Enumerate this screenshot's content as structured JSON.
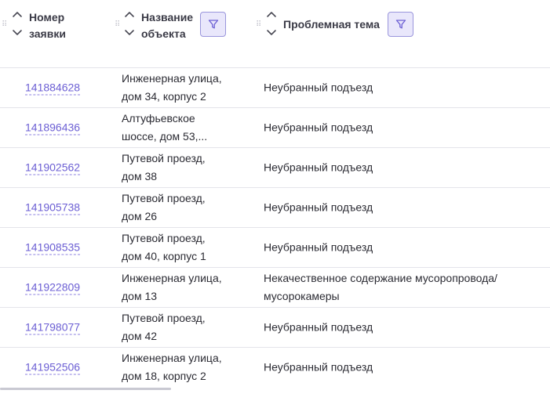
{
  "columns": {
    "number": {
      "title_line1": "Номер",
      "title_line2": "заявки"
    },
    "object": {
      "title_line1": "Название",
      "title_line2": "объекта"
    },
    "topic": {
      "title_line1": "Проблемная тема"
    }
  },
  "rows": [
    {
      "number": "141884628",
      "object_line1": "Инженерная улица,",
      "object_line2": "дом 34, корпус 2",
      "topic_line1": "Неубранный подъезд",
      "topic_line2": ""
    },
    {
      "number": "141896436",
      "object_line1": "Алтуфьевское",
      "object_line2": "шоссе, дом 53,...",
      "topic_line1": "Неубранный подъезд",
      "topic_line2": ""
    },
    {
      "number": "141902562",
      "object_line1": "Путевой проезд,",
      "object_line2": "дом 38",
      "topic_line1": "Неубранный подъезд",
      "topic_line2": ""
    },
    {
      "number": "141905738",
      "object_line1": "Путевой проезд,",
      "object_line2": "дом 26",
      "topic_line1": "Неубранный подъезд",
      "topic_line2": ""
    },
    {
      "number": "141908535",
      "object_line1": "Путевой проезд,",
      "object_line2": "дом 40, корпус 1",
      "topic_line1": "Неубранный подъезд",
      "topic_line2": ""
    },
    {
      "number": "141922809",
      "object_line1": "Инженерная улица,",
      "object_line2": "дом 13",
      "topic_line1": "Некачественное содержание мусоропровода/",
      "topic_line2": "мусорокамеры"
    },
    {
      "number": "141798077",
      "object_line1": "Путевой проезд,",
      "object_line2": "дом 42",
      "topic_line1": "Неубранный подъезд",
      "topic_line2": ""
    },
    {
      "number": "141952506",
      "object_line1": "Инженерная улица,",
      "object_line2": "дом 18, корпус 2",
      "topic_line1": "Неубранный подъезд",
      "topic_line2": ""
    }
  ],
  "colors": {
    "link": "#6c5fd4",
    "filter_bg": "#e9e7fb",
    "filter_border": "#9a96dc",
    "divider": "#e4e4ea"
  },
  "icons": {
    "sort": "chevron-up-down-icon",
    "filter": "funnel-icon",
    "drag": "drag-handle-icon"
  }
}
